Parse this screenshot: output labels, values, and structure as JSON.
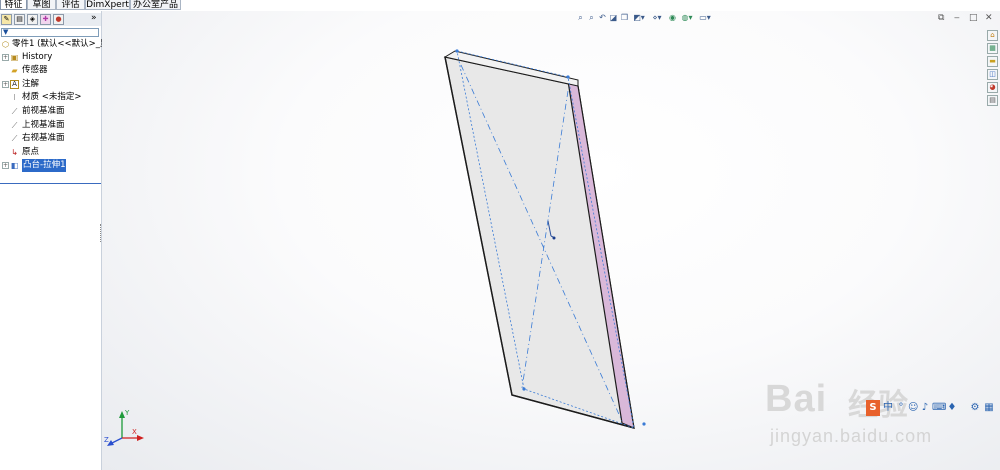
{
  "command_tabs": [
    "特征",
    "草图",
    "评估",
    "DimXpert",
    "办公室产品"
  ],
  "command_more": "»",
  "panel_tabs": {
    "icons": [
      "feature-manager-icon",
      "property-manager-icon",
      "configuration-manager-icon",
      "dimxpert-manager-icon",
      "display-manager-icon"
    ],
    "more": "»"
  },
  "filter_glyph": "▼",
  "tree": {
    "root_label": "零件1 (默认<<默认>_显",
    "items": [
      {
        "label": "History",
        "icon": "history-folder-icon",
        "expand": "+"
      },
      {
        "label": "传感器",
        "icon": "sensors-folder-icon",
        "expand": ""
      },
      {
        "label": "注解",
        "icon": "annotations-icon",
        "expand": "+"
      },
      {
        "label": "材质 <未指定>",
        "icon": "material-icon",
        "expand": ""
      },
      {
        "label": "前视基准面",
        "icon": "plane-icon",
        "expand": ""
      },
      {
        "label": "上视基准面",
        "icon": "plane-icon",
        "expand": ""
      },
      {
        "label": "右视基准面",
        "icon": "plane-icon",
        "expand": ""
      },
      {
        "label": "原点",
        "icon": "origin-icon",
        "expand": ""
      },
      {
        "label": "凸台-拉伸1",
        "icon": "boss-extrude-icon",
        "expand": "+"
      }
    ]
  },
  "heads_up_icons": [
    "zoom-to-fit-icon",
    "zoom-to-area-icon",
    "previous-view-icon",
    "section-view-icon",
    "view-orientation-icon",
    "display-style-icon",
    "hide-show-items-icon",
    "edit-appearance-icon",
    "apply-scene-icon",
    "view-settings-icon"
  ],
  "window_buttons": {
    "restore": "⧉",
    "minimize": "‒",
    "maximize": "□",
    "close": "✕"
  },
  "model_colors": {
    "face": "#e8e8e8",
    "side": "#d9b8d9",
    "edge": "#1c1c1c",
    "sketch": "#3a7bd5"
  },
  "triad": {
    "x": "X",
    "y": "Y",
    "z": "Z"
  },
  "taskpane_icons": [
    "home-icon",
    "design-library-icon",
    "file-explorer-icon",
    "view-palette-icon",
    "appearances-icon",
    "custom-properties-icon"
  ],
  "watermark": {
    "brand": "Bai",
    "brand2": "经验",
    "url": "jingyan.baidu.com"
  },
  "tray_icons": [
    "ime-icon",
    "punctuation-icon",
    "emoji-icon",
    "microphone-icon",
    "keyboard-icon",
    "skin-icon",
    "toolbox-icon",
    "apps-icon"
  ],
  "tray_ime": "中"
}
